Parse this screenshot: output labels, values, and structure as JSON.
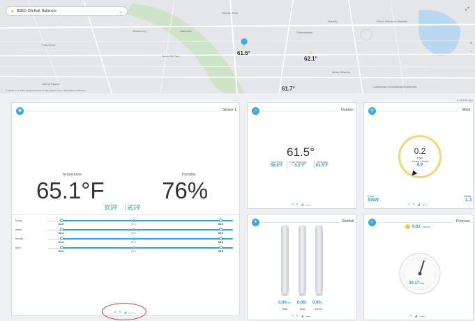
{
  "map": {
    "station_label": "BSEC-OlinHall, Baltimore",
    "places": [
      {
        "name": "Woodberry"
      },
      {
        "name": "Hampden"
      },
      {
        "name": "Druid Hill Park"
      },
      {
        "name": "Wyman Park"
      },
      {
        "name": "Oakenshawe"
      },
      {
        "name": "Waverly"
      },
      {
        "name": "Ednor Gardens-Lakeside"
      },
      {
        "name": "Park Circle"
      },
      {
        "name": "Liberty Square"
      },
      {
        "name": "Better Waverly"
      },
      {
        "name": "Coldstream Homestead Montebello"
      }
    ],
    "pins": [
      {
        "value": "61.5°"
      },
      {
        "value": "62.1°"
      },
      {
        "value": "61.7°"
      }
    ],
    "attribution": "© Mapbox, 1-1 2025. All rights reserved. | Map legend | © OpenStreetMap contributors",
    "updated": "a minute ago"
  },
  "sensor": {
    "title": "Sensor 1",
    "temp_label": "Temperature",
    "temp_value": "65.1°F",
    "hum_label": "Humidity",
    "hum_value": "76%",
    "dew_label": "Dew Point",
    "dew_value": "57.3°F",
    "feels_label": "Feels Like",
    "feels_value": "65.1°F",
    "ranges": [
      {
        "label": "today",
        "min": "64.5",
        "mid": "65.0",
        "max": "65.5"
      },
      {
        "label": "week",
        "min": "64.4",
        "mid": "65.0",
        "max": "65.5"
      },
      {
        "label": "month",
        "min": "64.4",
        "mid": "65.0",
        "max": "65.5"
      },
      {
        "label": "year",
        "min": "64.4",
        "mid": "65.0",
        "max": "65.5"
      }
    ]
  },
  "outdoor": {
    "title": "Outdoor",
    "temp": "61.5°",
    "dew_label": "Dew Point",
    "dew_value": "58.8°F",
    "yest_label": "From Yesterday",
    "yest_value": "↑ 5.6°F",
    "feels_label": "Feels Like",
    "feels_value": "61.5°F"
  },
  "wind": {
    "title": "Wind",
    "speed": "0.2",
    "high_label": "High",
    "peak_label": "Today's Peak",
    "peak_value": "6.9",
    "from_label": "From",
    "from_value": "SSW",
    "gusts_label": "Gusts",
    "gusts_value": "1.1"
  },
  "rainfall": {
    "title": "Rainfall",
    "rate_value": "0.00",
    "rate_unit": "in/hr",
    "day_value": "0.00",
    "day_unit": "in",
    "event_value": "0.00",
    "event_unit": "in",
    "rate_label": "Rate",
    "day_label": "Day",
    "event_label": "Event"
  },
  "pressure": {
    "title": "Pressure",
    "trend_value": "0.01",
    "trend_unit": "inHg/hr",
    "value": "30.17",
    "unit": "inHg"
  },
  "colors": {
    "accent": "#3ea8e0",
    "value_blue": "#2d9ad6",
    "annotation_red": "#e03a3a",
    "gauge_yellow": "#f2d678"
  }
}
